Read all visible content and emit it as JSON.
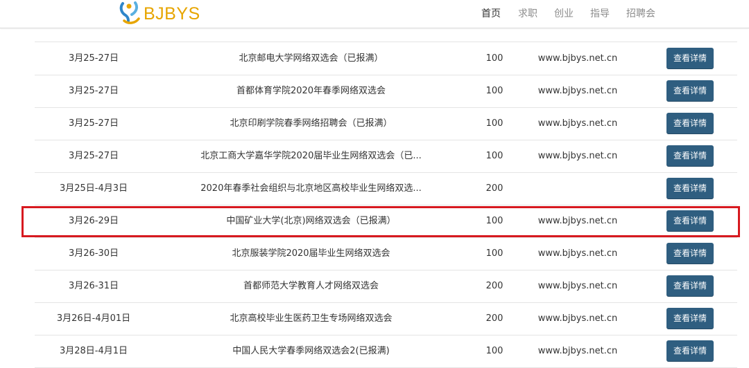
{
  "header": {
    "logo_text": "BJBYS",
    "nav": [
      {
        "label": "首页",
        "active": true
      },
      {
        "label": "求职",
        "active": false
      },
      {
        "label": "创业",
        "active": false
      },
      {
        "label": "指导",
        "active": false
      },
      {
        "label": "招聘会",
        "active": false
      }
    ]
  },
  "table": {
    "button_label": "查看详情",
    "rows": [
      {
        "date": "3月25-27日",
        "title": "北京邮电大学网络双选会（已报满）",
        "quota": "100",
        "site": "www.bjbys.net.cn"
      },
      {
        "date": "3月25-27日",
        "title": "首都体育学院2020年春季网络双选会",
        "quota": "100",
        "site": "www.bjbys.net.cn"
      },
      {
        "date": "3月25-27日",
        "title": "北京印刷学院春季网络招聘会（已报满）",
        "quota": "100",
        "site": "www.bjbys.net.cn"
      },
      {
        "date": "3月25-27日",
        "title": "北京工商大学嘉华学院2020届毕业生网络双选会（已...",
        "quota": "100",
        "site": "www.bjbys.net.cn"
      },
      {
        "date": "3月25日-4月3日",
        "title": "2020年春季社会组织与北京地区高校毕业生网络双选...",
        "quota": "200",
        "site": ""
      },
      {
        "date": "3月26-29日",
        "title": "中国矿业大学(北京)网络双选会（已报满）",
        "quota": "100",
        "site": "www.bjbys.net.cn"
      },
      {
        "date": "3月26-30日",
        "title": "北京服装学院2020届毕业生网络双选会",
        "quota": "100",
        "site": "www.bjbys.net.cn"
      },
      {
        "date": "3月26-31日",
        "title": "首都师范大学教育人才网络双选会",
        "quota": "200",
        "site": "www.bjbys.net.cn"
      },
      {
        "date": "3月26日-4月01日",
        "title": "北京高校毕业生医药卫生专场网络双选会",
        "quota": "200",
        "site": "www.bjbys.net.cn"
      },
      {
        "date": "3月28日-4月1日",
        "title": "中国人民大学春季网络双选会2(已报满)",
        "quota": "100",
        "site": "www.bjbys.net.cn"
      }
    ]
  },
  "highlight": {
    "row_index": 5,
    "color": "#d7191f"
  },
  "colors": {
    "button": "#2f5e80",
    "logo": "#e7a500"
  }
}
